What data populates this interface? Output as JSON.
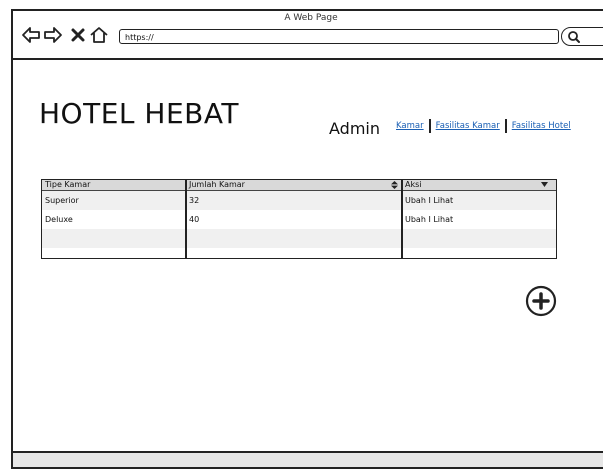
{
  "browser": {
    "page_title": "A Web Page",
    "url": "https://"
  },
  "header": {
    "brand": "HOTEL HEBAT",
    "role": "Admin",
    "links": [
      "Kamar",
      "Fasilitas Kamar",
      "Fasilitas Hotel"
    ]
  },
  "table": {
    "columns": [
      "Tipe Kamar",
      "Jumlah Kamar",
      "Aksi"
    ],
    "rows": [
      [
        "Superior",
        "32",
        "Ubah I Lihat"
      ],
      [
        "Deluxe",
        "40",
        "Ubah I Lihat"
      ]
    ]
  },
  "icons": {
    "back": "back-arrow-icon",
    "forward": "forward-arrow-icon",
    "close": "close-icon",
    "home": "home-icon",
    "search": "search-icon",
    "add": "plus-icon"
  }
}
